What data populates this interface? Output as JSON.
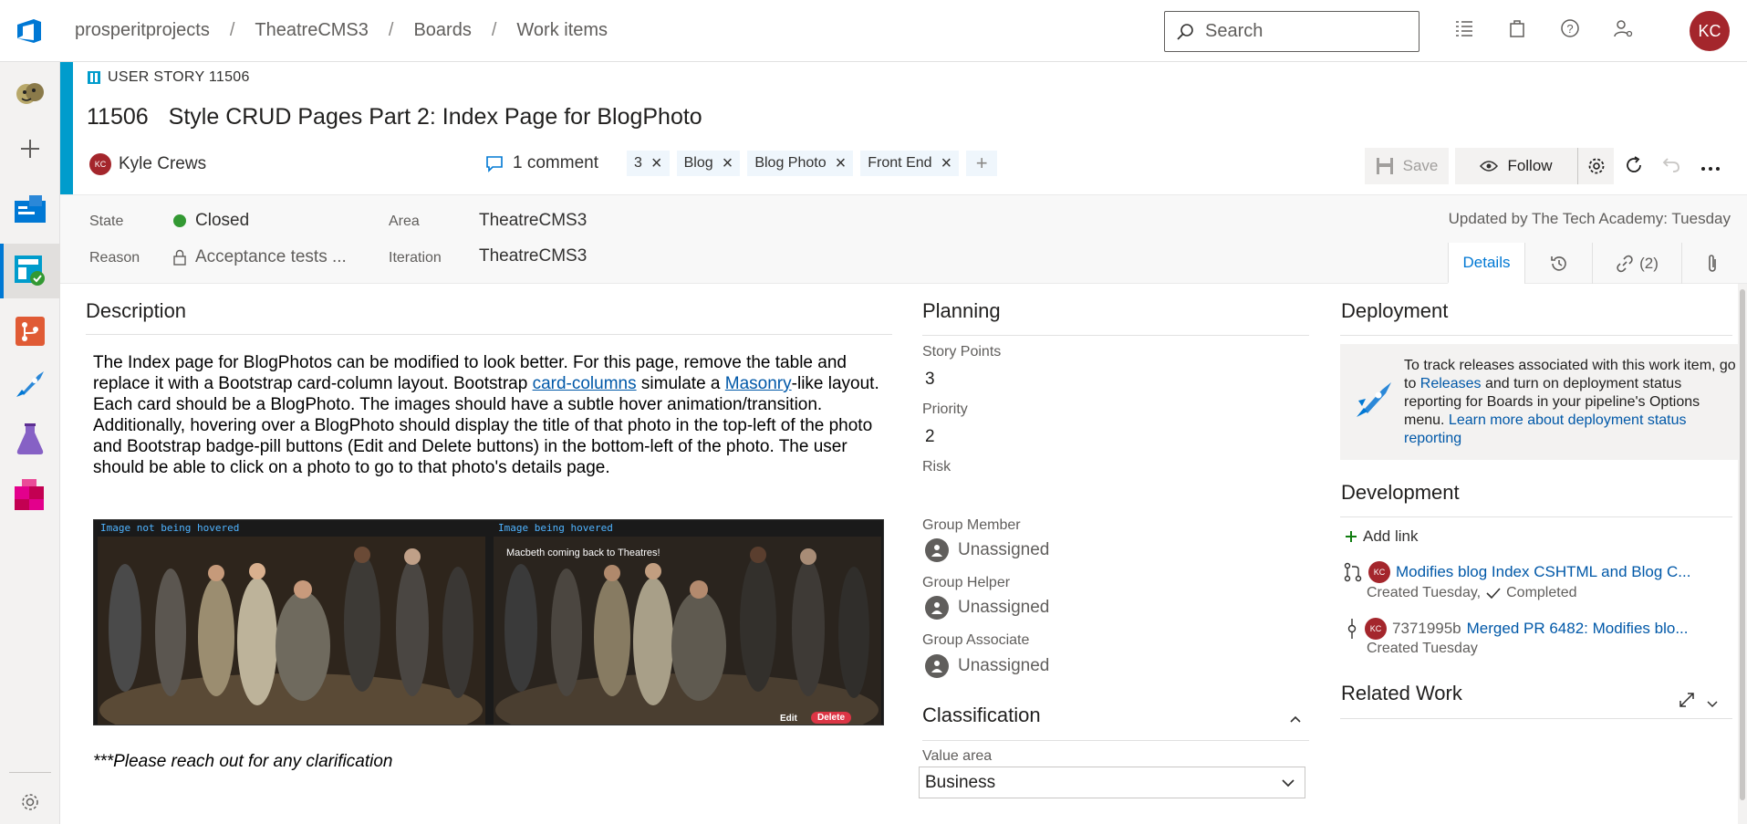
{
  "breadcrumb": [
    "prosperitprojects",
    "TheatreCMS3",
    "Boards",
    "Work items"
  ],
  "search": {
    "placeholder": "Search"
  },
  "user": {
    "initials": "KC"
  },
  "work_item": {
    "type_label": "USER STORY 11506",
    "id": "11506",
    "title": "Style CRUD Pages Part 2: Index Page for BlogPhoto",
    "assigned_to": "Kyle Crews",
    "assigned_initials": "KC",
    "comments": "1 comment",
    "tags": [
      "3",
      "Blog",
      "Blog Photo",
      "Front End"
    ],
    "save_label": "Save",
    "follow_label": "Follow"
  },
  "fields": {
    "state_label": "State",
    "state_value": "Closed",
    "reason_label": "Reason",
    "reason_value": "Acceptance tests ...",
    "area_label": "Area",
    "area_value": "TheatreCMS3",
    "iteration_label": "Iteration",
    "iteration_value": "TheatreCMS3",
    "updated_by": "Updated by The Tech Academy: Tuesday"
  },
  "tabs": {
    "details": "Details",
    "links": "(2)"
  },
  "description": {
    "heading": "Description",
    "p1": "The Index page for BlogPhotos can be modified to look better.  For this page, remove the table and replace it with a Bootstrap card-column layout.  Bootstrap ",
    "link1": "card-columns",
    "p2": " simulate a ",
    "link2": "Masonry",
    "p3": "-like layout.  Each card should be a BlogPhoto.  The images should have a subtle hover animation/transition.  Additionally, hovering over a BlogPhoto should display the title of that photo in the top-left of the photo and Bootstrap badge-pill buttons (Edit and Delete buttons) in the bottom-left of the photo.  The user should be able to click on a photo to go to that photo's details page.",
    "img_label_left": "Image not being hovered",
    "img_label_right": "Image being hovered",
    "img_caption": "Macbeth coming back to Theatres!",
    "img_edit": "Edit",
    "img_delete": "Delete",
    "clarify": "***Please reach out for any clarification"
  },
  "planning": {
    "heading": "Planning",
    "story_points_label": "Story Points",
    "story_points": "3",
    "priority_label": "Priority",
    "priority": "2",
    "risk_label": "Risk",
    "group_member_label": "Group Member",
    "group_member": "Unassigned",
    "group_helper_label": "Group Helper",
    "group_helper": "Unassigned",
    "group_associate_label": "Group Associate",
    "group_associate": "Unassigned"
  },
  "classification": {
    "heading": "Classification",
    "value_area_label": "Value area",
    "value_area": "Business"
  },
  "deployment": {
    "heading": "Deployment",
    "t1": "To track releases associated with this work item, go to ",
    "releases": "Releases",
    "t2": " and turn on deployment status reporting for Boards in your pipeline's Options menu. ",
    "learn": "Learn more about deployment status reporting"
  },
  "development": {
    "heading": "Development",
    "add_link": "Add link",
    "pr_title": "Modifies blog Index CSHTML and Blog C...",
    "pr_created": "Created Tuesday,",
    "pr_status": "Completed",
    "commit_id": "7371995b",
    "commit_title": "Merged PR 6482: Modifies blo...",
    "commit_created": "Created Tuesday"
  },
  "related": {
    "heading": "Related Work"
  },
  "colors": {
    "accent": "#009ccc",
    "brand": "#0078d4",
    "avatar": "#a4262c",
    "state_closed": "#339933"
  }
}
